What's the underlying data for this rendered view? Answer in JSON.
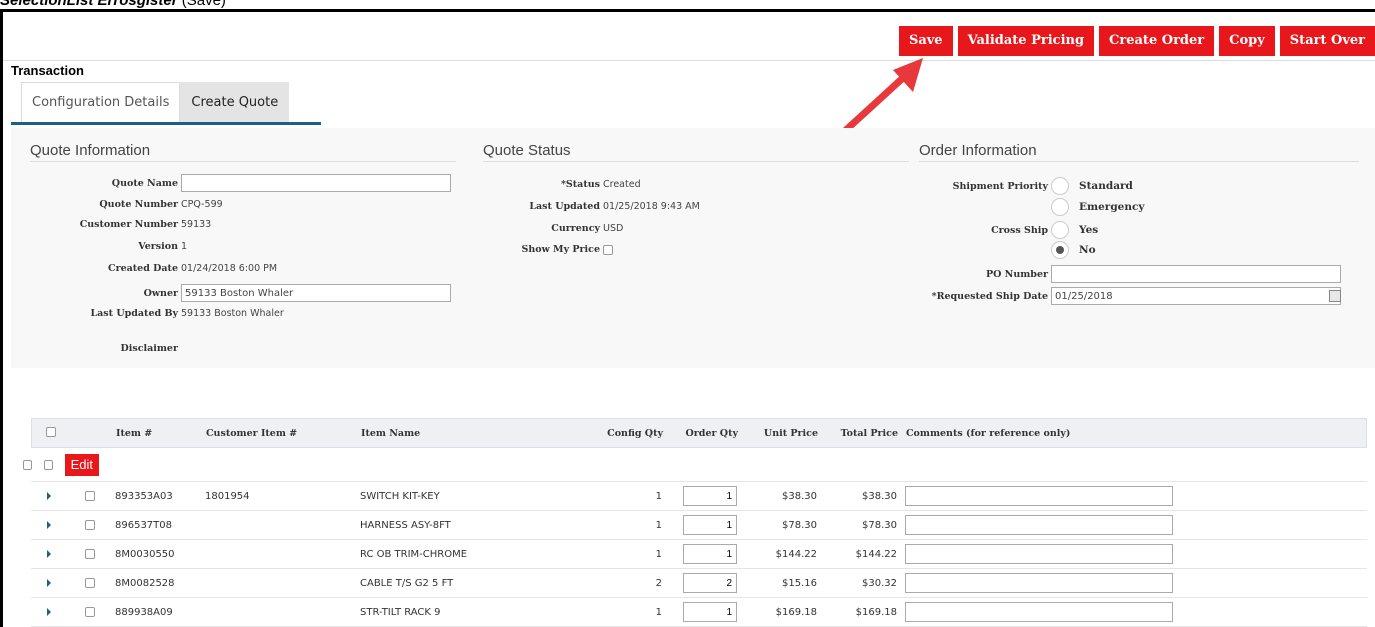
{
  "caption": {
    "title": "SelectionList Errosgister",
    "suffix": " (Save)"
  },
  "toolbar": {
    "save": "Save",
    "validate": "Validate Pricing",
    "create_order": "Create Order",
    "copy": "Copy",
    "start_over": "Start Over"
  },
  "transaction_title": "Transaction",
  "tabs": {
    "config": "Configuration Details",
    "create_quote": "Create Quote"
  },
  "quote_info": {
    "title": "Quote Information",
    "quote_name_label": "Quote Name",
    "quote_name_value": "",
    "quote_number_label": "Quote Number",
    "quote_number_value": "CPQ-599",
    "customer_number_label": "Customer Number",
    "customer_number_value": "59133",
    "version_label": "Version",
    "version_value": "1",
    "created_date_label": "Created Date",
    "created_date_value": "01/24/2018 6:00 PM",
    "owner_label": "Owner",
    "owner_value": "59133 Boston Whaler",
    "last_updated_by_label": "Last Updated By",
    "last_updated_by_value": "59133 Boston Whaler",
    "disclaimer_label": "Disclaimer"
  },
  "quote_status": {
    "title": "Quote Status",
    "status_label": "*Status",
    "status_value": "Created",
    "last_updated_label": "Last Updated",
    "last_updated_value": "01/25/2018 9:43 AM",
    "currency_label": "Currency",
    "currency_value": "USD",
    "show_price_label": "Show My Price"
  },
  "order_info": {
    "title": "Order Information",
    "shipment_priority_label": "Shipment Priority",
    "standard": "Standard",
    "emergency": "Emergency",
    "cross_ship_label": "Cross Ship",
    "yes": "Yes",
    "no": "No",
    "po_number_label": "PO Number",
    "po_number_value": "",
    "requested_ship_date_label": "*Requested Ship Date",
    "requested_ship_date_value": "01/25/2018"
  },
  "grid": {
    "headers": {
      "item": "Item #",
      "customer_item": "Customer Item #",
      "item_name": "Item Name",
      "config_qty": "Config Qty",
      "order_qty": "Order Qty",
      "unit_price": "Unit Price",
      "total_price": "Total Price",
      "comments": "Comments (for reference only)"
    },
    "edit_label": "Edit",
    "rows": [
      {
        "item": "893353A03",
        "customer_item": "1801954",
        "name": "SWITCH KIT-KEY",
        "config_qty": "1",
        "order_qty": "1",
        "unit_price": "$38.30",
        "total_price": "$38.30"
      },
      {
        "item": "896537T08",
        "customer_item": "",
        "name": "HARNESS ASY-8FT",
        "config_qty": "1",
        "order_qty": "1",
        "unit_price": "$78.30",
        "total_price": "$78.30"
      },
      {
        "item": "8M0030550",
        "customer_item": "",
        "name": "RC OB TRIM-CHROME",
        "config_qty": "1",
        "order_qty": "1",
        "unit_price": "$144.22",
        "total_price": "$144.22"
      },
      {
        "item": "8M0082528",
        "customer_item": "",
        "name": "CABLE T/S G2 5 FT",
        "config_qty": "2",
        "order_qty": "2",
        "unit_price": "$15.16",
        "total_price": "$30.32"
      },
      {
        "item": "889938A09",
        "customer_item": "",
        "name": "STR-TILT RACK 9",
        "config_qty": "1",
        "order_qty": "1",
        "unit_price": "$169.18",
        "total_price": "$169.18"
      }
    ]
  },
  "colors": {
    "accent_red": "#e8171c",
    "tab_underline": "#1d5f8a",
    "annotation_arrow": "#e8383b"
  }
}
